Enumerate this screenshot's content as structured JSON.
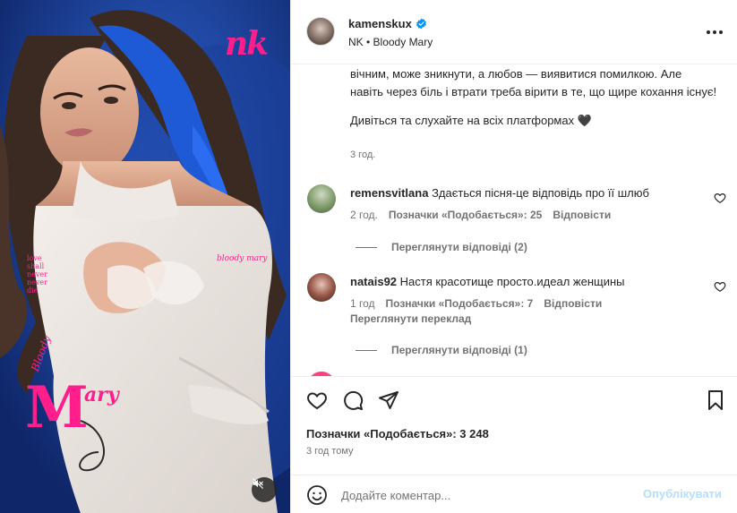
{
  "colors": {
    "accent_pink": "#ff1e8c",
    "background_blue": "#1c3f9c",
    "link_blue_disabled": "#b2dffc",
    "secondary_text": "#737373",
    "verified_blue": "#0095f6"
  },
  "media": {
    "brand_logo": "nk",
    "poster_text_love": "love\nshall\nnever\nnever\ndie",
    "poster_text_bloody_small": "bloody mary",
    "poster_text_bloody": "Bloody",
    "poster_text_mary_initial": "M",
    "poster_text_mary_rest": "ary",
    "mute_icon": "speaker-muted-icon"
  },
  "header": {
    "username": "kamenskux",
    "verified_icon": "verified-badge-icon",
    "subtitle": "NK • Bloody Mary",
    "more_icon": "more-horizontal-icon"
  },
  "caption": {
    "text": "вічним, може зникнути, а любов — виявитися помилкою. Але навіть через біль і втрати треба вірити в те, що щире кохання існує!",
    "follow_text": "Дивіться та слухайте на всіх платформах 🖤",
    "time": "3 год."
  },
  "comments": [
    {
      "username": "remensvitlana",
      "text": "Здається пісня-це відповідь про її шлюб",
      "time": "2 год.",
      "likes": "Позначки «Подобається»: 25",
      "reply": "Відповісти",
      "view_replies": "Переглянути відповіді (2)"
    },
    {
      "username": "natais92",
      "text": "Настя красотище просто.идеал женщины",
      "time": "1 год",
      "likes": "Позначки «Подобається»: 7",
      "reply": "Відповісти",
      "translate": "Переглянути переклад",
      "view_replies": "Переглянути відповіді (1)"
    }
  ],
  "actions": {
    "like_icon": "heart-icon",
    "comment_icon": "comment-icon",
    "share_icon": "send-icon",
    "save_icon": "bookmark-icon",
    "likes_text": "Позначки «Подобається»: 3 248",
    "time_ago": "3 год тому"
  },
  "comment_box": {
    "emoji_icon": "emoji-icon",
    "placeholder": "Додайте коментар...",
    "publish_label": "Опублікувати"
  }
}
